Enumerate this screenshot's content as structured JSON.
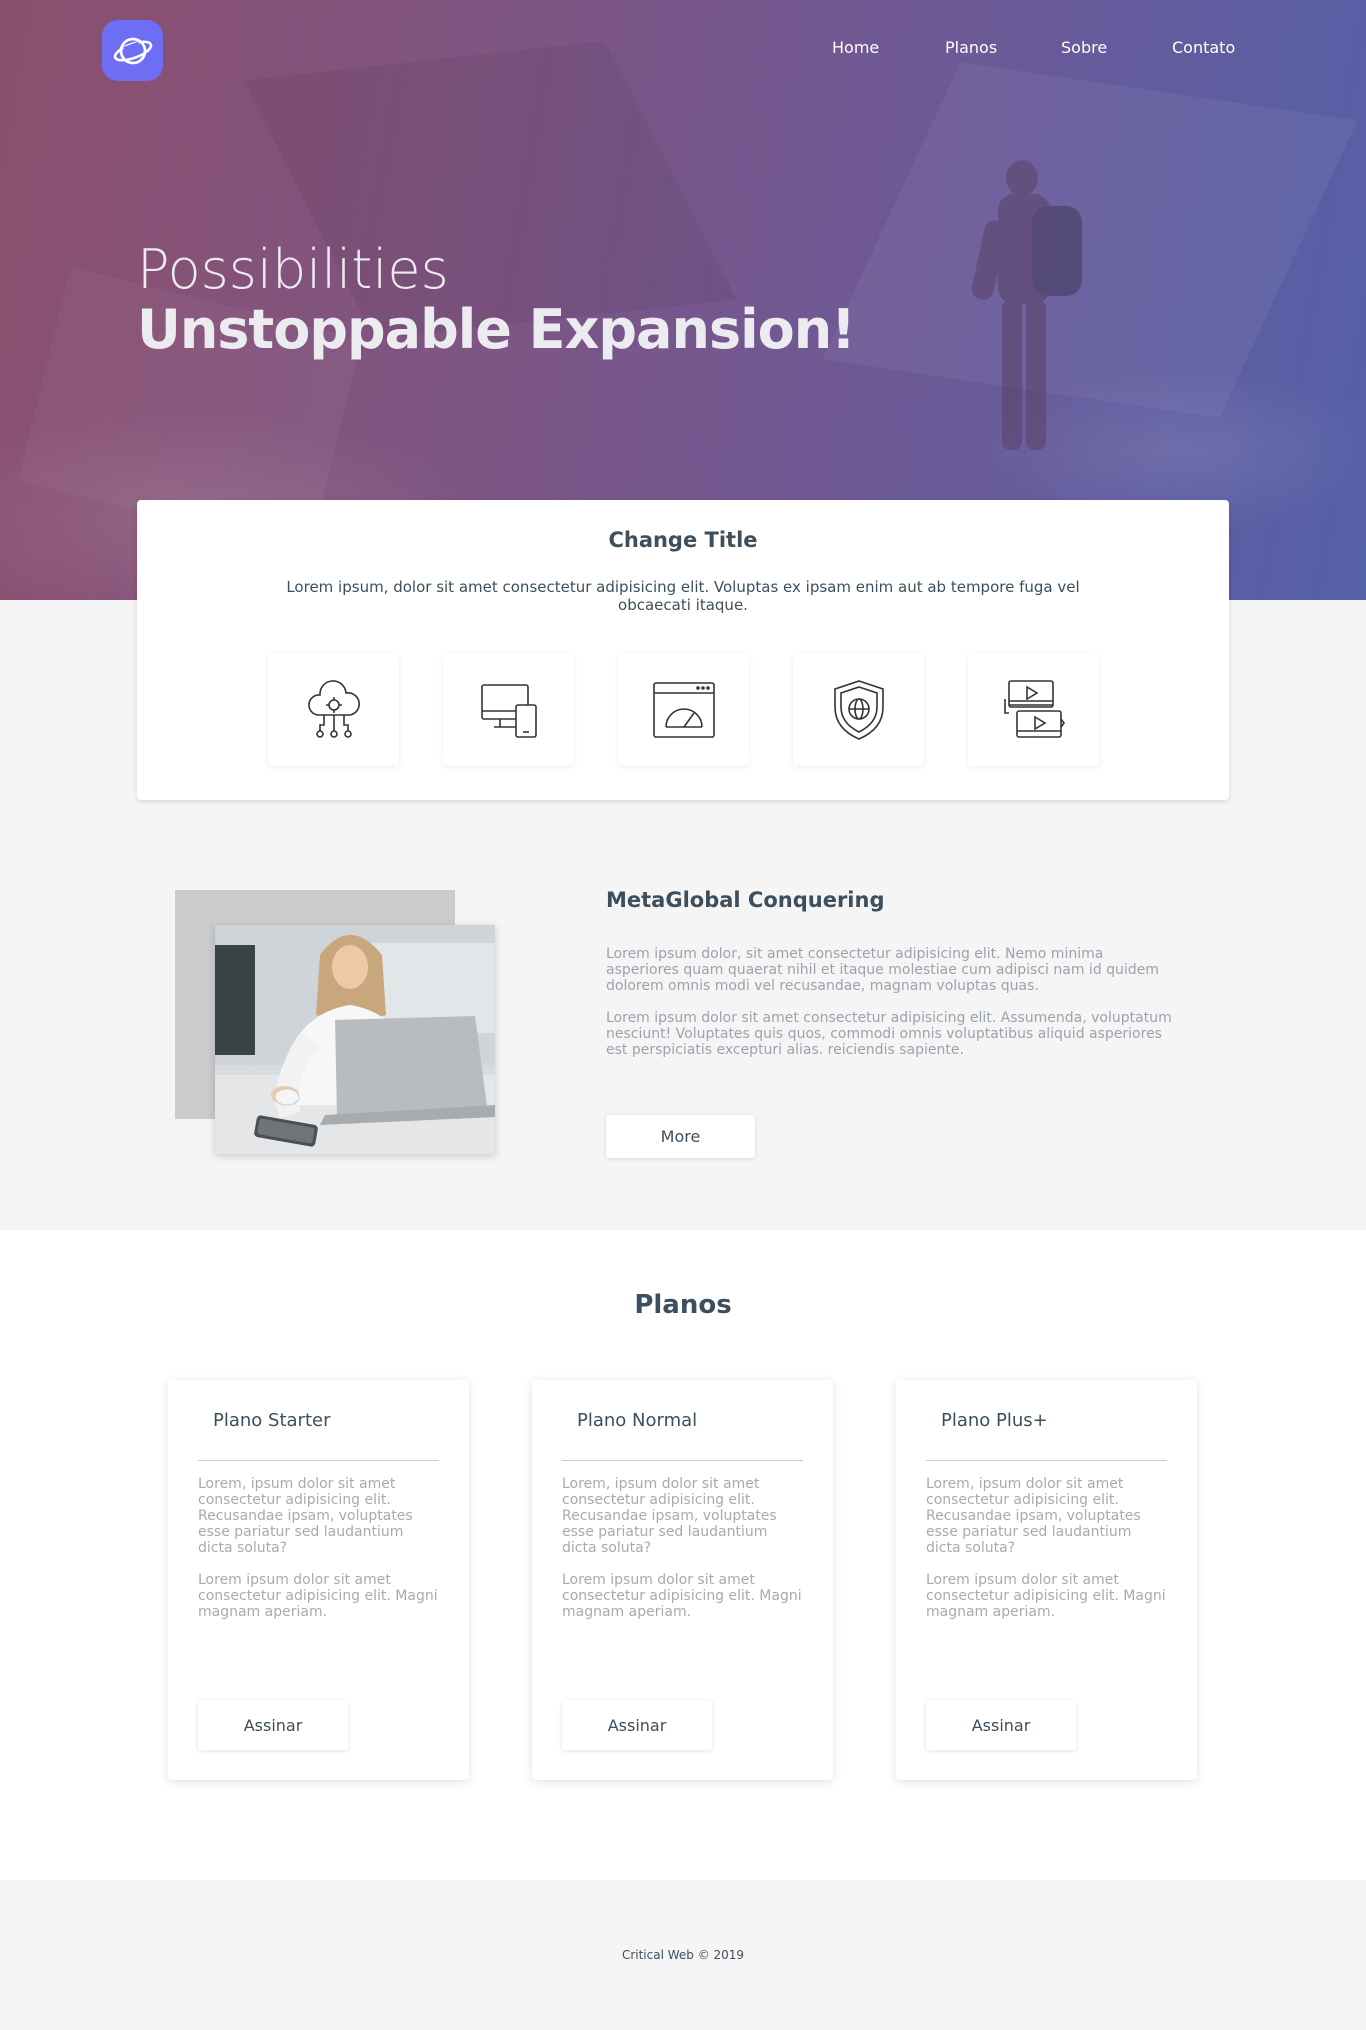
{
  "nav": {
    "items": [
      {
        "label": "Home"
      },
      {
        "label": "Planos"
      },
      {
        "label": "Sobre"
      },
      {
        "label": "Contato"
      }
    ]
  },
  "hero": {
    "line1": "Possibilities",
    "line2": "Unstoppable Expansion!"
  },
  "feature": {
    "title": "Change Title",
    "text": "Lorem ipsum, dolor sit amet consectetur adipisicing elit. Voluptas ex ipsam enim aut ab tempore fuga vel obcaecati itaque.",
    "icons": [
      "cloud-network-icon",
      "devices-icon",
      "speed-dashboard-icon",
      "globe-shield-icon",
      "video-files-icon"
    ]
  },
  "about": {
    "title": "MetaGlobal Conquering",
    "paragraph1": "Lorem ipsum dolor, sit amet consectetur adipisicing elit. Nemo minima asperiores quam quaerat nihil et itaque molestiae cum adipisci nam id quidem dolorem omnis modi vel recusandae, magnam voluptas quas.",
    "paragraph2": "Lorem ipsum dolor sit amet consectetur adipisicing elit. Assumenda, voluptatum nesciunt! Voluptates quis quos, commodi omnis voluptatibus aliquid asperiores est perspiciatis excepturi alias. reiciendis sapiente.",
    "button_label": "More"
  },
  "planos": {
    "title": "Planos",
    "plans": [
      {
        "name": "Plano Starter",
        "p1": "Lorem, ipsum dolor sit amet consectetur adipisicing elit. Recusandae ipsam, voluptates esse pariatur sed laudantium dicta soluta?",
        "p2": "Lorem ipsum dolor sit amet consectetur adipisicing elit. Magni magnam aperiam.",
        "button": "Assinar"
      },
      {
        "name": "Plano Normal",
        "p1": "Lorem, ipsum dolor sit amet consectetur adipisicing elit. Recusandae ipsam, voluptates esse pariatur sed laudantium dicta soluta?",
        "p2": "Lorem ipsum dolor sit amet consectetur adipisicing elit. Magni magnam aperiam.",
        "button": "Assinar"
      },
      {
        "name": "Plano Plus+",
        "p1": "Lorem, ipsum dolor sit amet consectetur adipisicing elit. Recusandae ipsam, voluptates esse pariatur sed laudantium dicta soluta?",
        "p2": "Lorem ipsum dolor sit amet consectetur adipisicing elit. Magni magnam aperiam.",
        "button": "Assinar"
      }
    ]
  },
  "footer": {
    "text": "Critical Web © 2019"
  },
  "colors": {
    "accent": "#6e6ef5",
    "hero_start": "#8b4f6e",
    "hero_end": "#5460a8",
    "text_dark": "#3d4f5c",
    "text_muted": "#9aa3ad"
  }
}
